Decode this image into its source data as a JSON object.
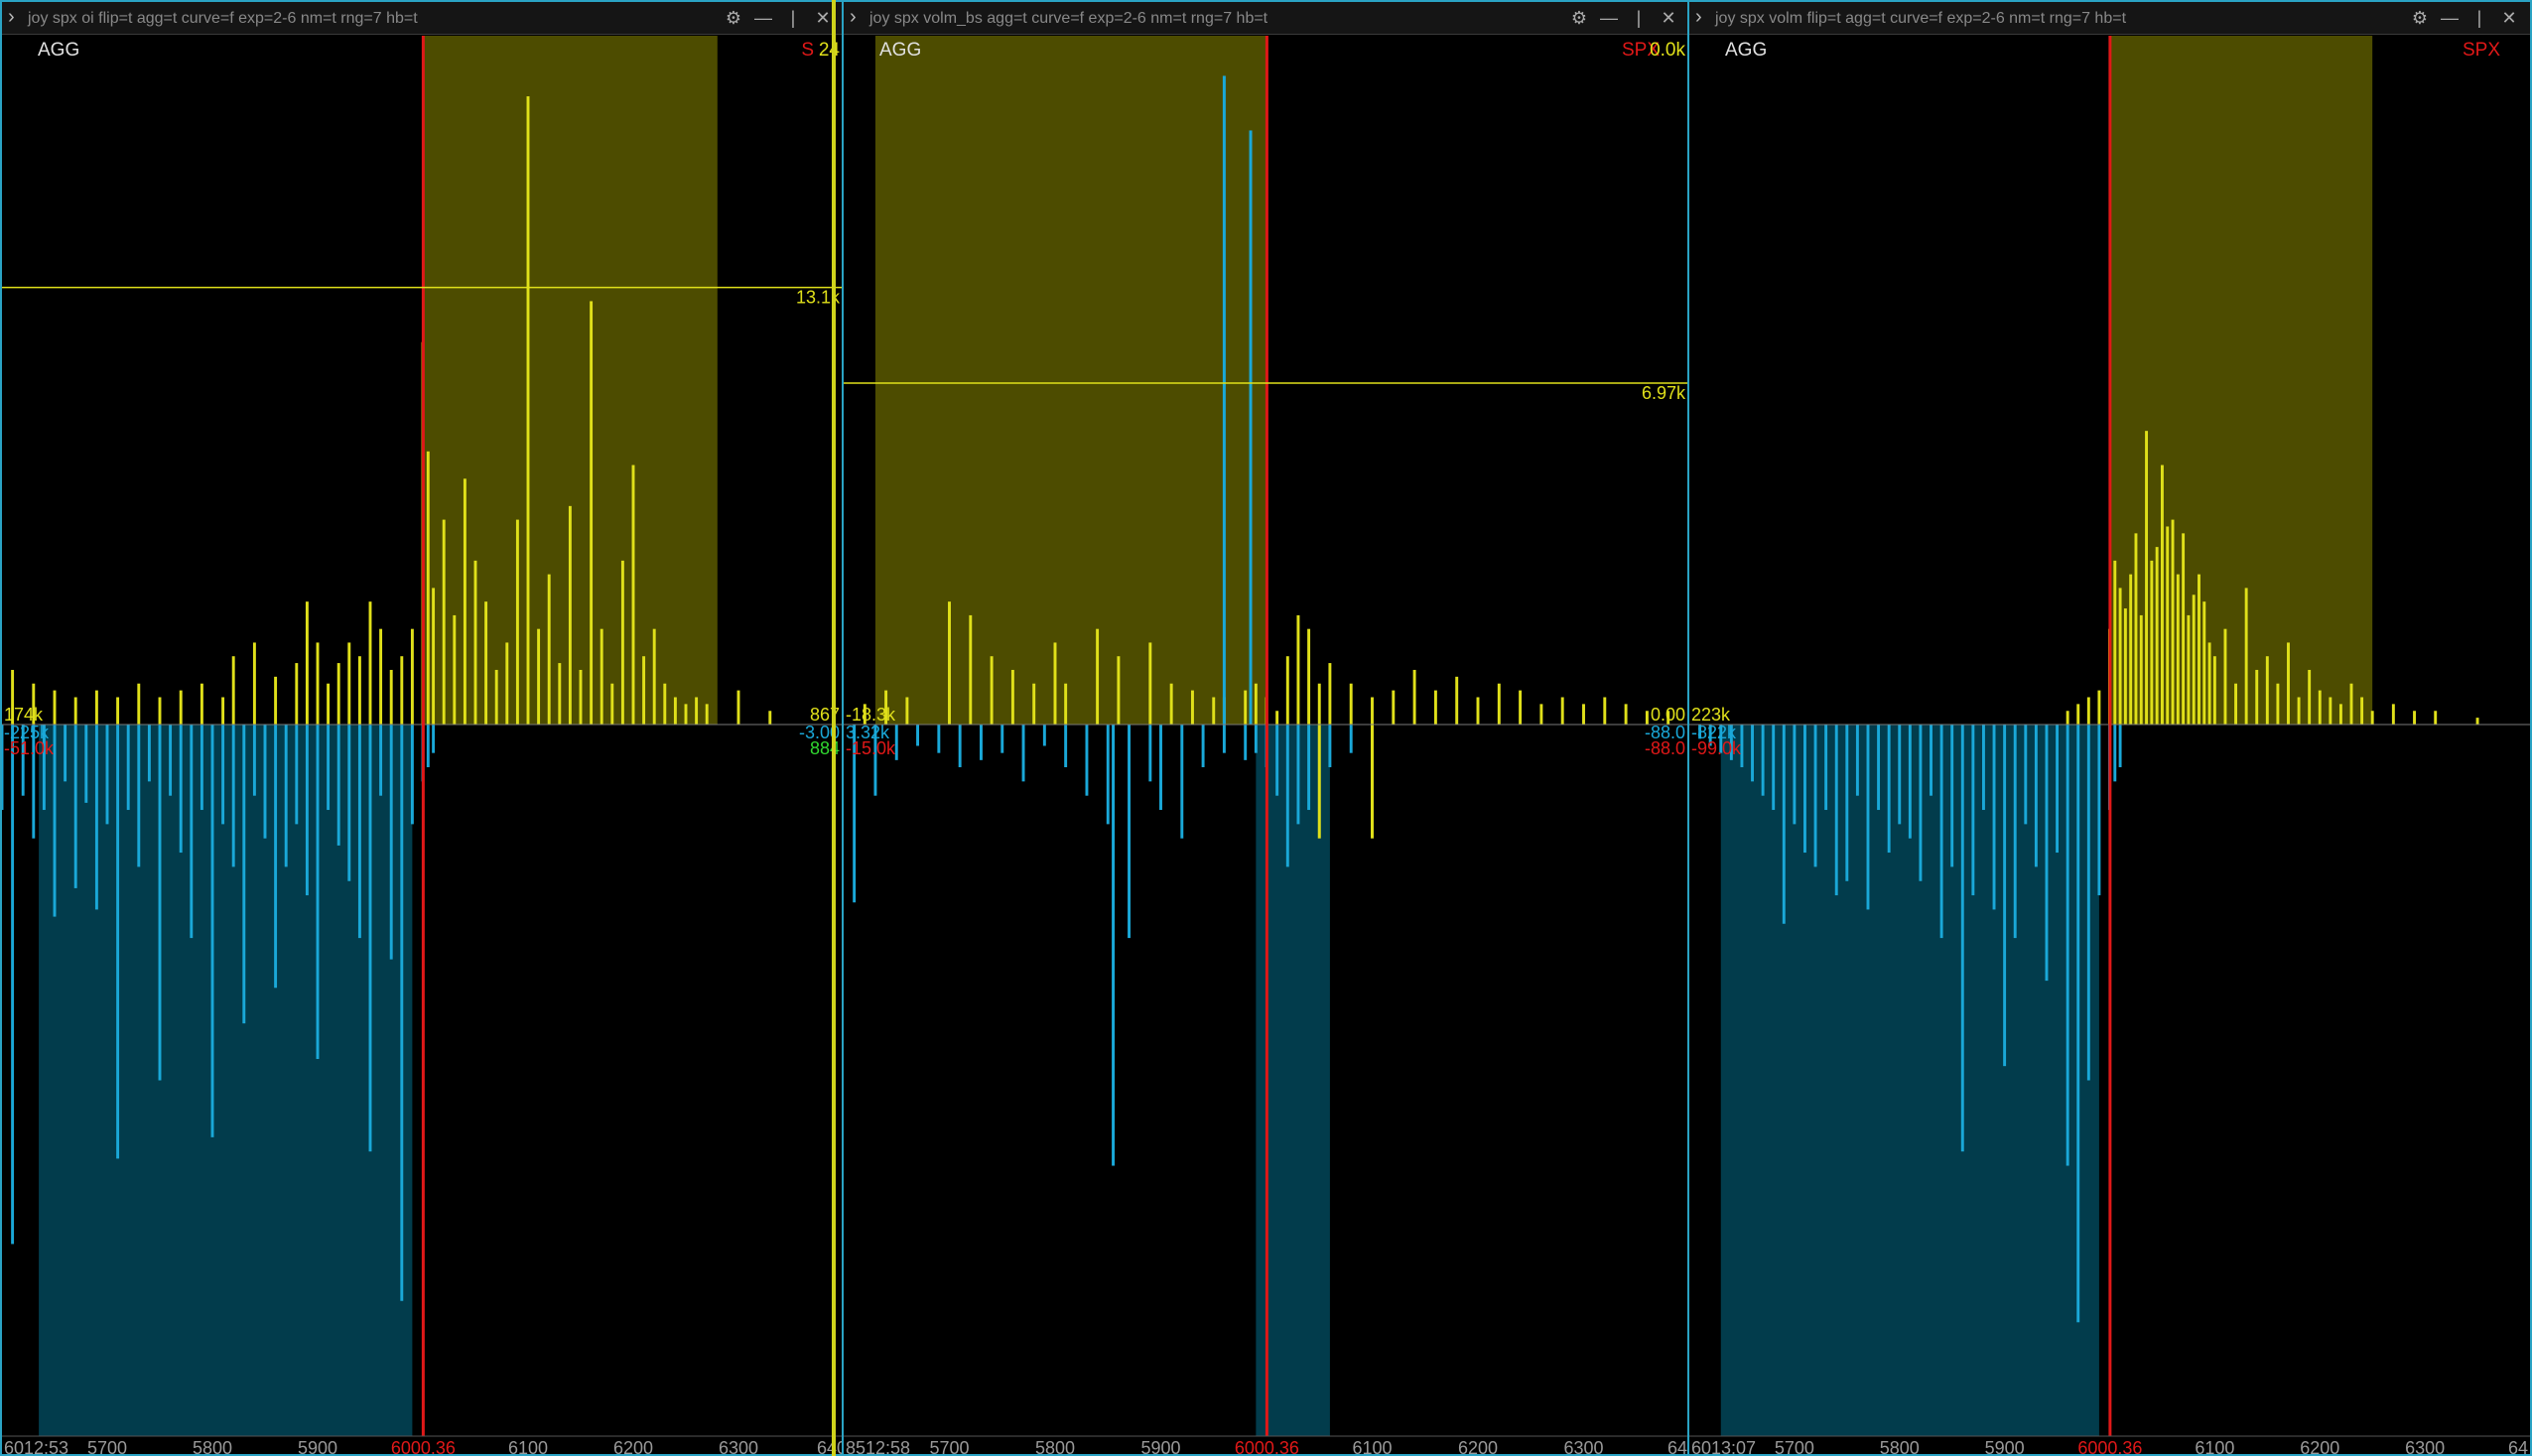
{
  "colors": {
    "yellow": "#e0e01a",
    "cyan": "#1aa8d8",
    "olive_band": "#4d4c00",
    "teal_band": "#023c4c",
    "red": "#e01818",
    "green": "#30d830",
    "border": "#2aa3c4"
  },
  "icons": [
    "chevron-right-icon",
    "gear-icon",
    "minimize-icon",
    "split-icon",
    "close-icon"
  ],
  "panels": [
    {
      "title": "joy spx oi flip=t agg=t curve=f exp=2-6 nm=t rng=7 hb=t",
      "agg_label": "AGG",
      "symbol_label": "S",
      "top_right_value": "24",
      "hline_value": "13.1k",
      "left_value_top": "174k",
      "left_value_mid": "-225k",
      "left_value_bot": "-51.0k",
      "right_value_top": "867",
      "right_value_mid": "-3.00",
      "right_value_bot": "884",
      "time_label": "6012:53",
      "price_marker": "6000.36",
      "x_ticks": [
        "5700",
        "5800",
        "5900",
        "6100",
        "6200",
        "6300",
        "640"
      ]
    },
    {
      "title": "joy spx volm_bs agg=t curve=f exp=2-6 nm=t rng=7 hb=t",
      "agg_label": "AGG",
      "symbol_label": "SPX",
      "top_right_value": "0.0k",
      "hline_value": "6.97k",
      "left_value_top": "-18.3k",
      "left_value_mid": "3.32k",
      "left_value_bot": "-15.0k",
      "right_value_top": "0.00",
      "right_value_mid": "-88.0",
      "right_value_bot": "-88.0",
      "time_label": "8512:58",
      "price_marker": "6000.36",
      "x_ticks": [
        "5700",
        "5800",
        "5900",
        "6100",
        "6200",
        "6300",
        "64"
      ]
    },
    {
      "title": "joy spx volm flip=t agg=t curve=f exp=2-6 nm=t rng=7 hb=t",
      "agg_label": "AGG",
      "symbol_label": "SPX",
      "top_right_value": "",
      "hline_value": "",
      "left_value_top": "223k",
      "left_value_mid": "-822k",
      "left_value_bot": "-99.0k",
      "right_value_top": "",
      "right_value_mid": "",
      "right_value_bot": "",
      "time_label": "6013:07",
      "price_marker": "6000.36",
      "x_ticks": [
        "5700",
        "5800",
        "5900",
        "6100",
        "6200",
        "6300",
        "64"
      ]
    }
  ],
  "chart_data": [
    {
      "type": "bar",
      "xlim": [
        5600,
        6400
      ],
      "price_marker": 6000.36,
      "upper_band": [
        6000,
        6280
      ],
      "lower_band": [
        5635,
        5990
      ],
      "hline_frac": 0.64,
      "series": [
        {
          "color": "yellow",
          "x": [
            5610,
            5630,
            5650,
            5670,
            5690,
            5710,
            5730,
            5750,
            5770,
            5790,
            5810,
            5820,
            5840,
            5860,
            5880,
            5890,
            5900,
            5910,
            5920,
            5930,
            5940,
            5950,
            5960,
            5970,
            5980,
            5990,
            6000,
            6005,
            6010,
            6020,
            6030,
            6040,
            6050,
            6060,
            6070,
            6080,
            6090,
            6100,
            6110,
            6120,
            6130,
            6140,
            6150,
            6160,
            6170,
            6180,
            6190,
            6200,
            6210,
            6220,
            6230,
            6240,
            6250,
            6260,
            6270,
            6300,
            6330
          ],
          "values": [
            0.08,
            0.06,
            0.05,
            0.04,
            0.05,
            0.04,
            0.06,
            0.04,
            0.05,
            0.06,
            0.04,
            0.1,
            0.12,
            0.07,
            0.09,
            0.18,
            0.12,
            0.06,
            0.09,
            0.12,
            0.1,
            0.18,
            0.14,
            0.08,
            0.1,
            0.14,
            0.56,
            0.4,
            0.2,
            0.3,
            0.16,
            0.36,
            0.24,
            0.18,
            0.08,
            0.12,
            0.3,
            0.92,
            0.14,
            0.22,
            0.09,
            0.32,
            0.08,
            0.62,
            0.14,
            0.06,
            0.24,
            0.38,
            0.1,
            0.14,
            0.06,
            0.04,
            0.03,
            0.04,
            0.03,
            0.05,
            0.02
          ]
        },
        {
          "color": "cyan",
          "x": [
            5600,
            5610,
            5620,
            5630,
            5640,
            5650,
            5660,
            5670,
            5680,
            5690,
            5700,
            5710,
            5720,
            5730,
            5740,
            5750,
            5760,
            5770,
            5780,
            5790,
            5800,
            5810,
            5820,
            5830,
            5840,
            5850,
            5860,
            5870,
            5880,
            5890,
            5900,
            5910,
            5920,
            5930,
            5940,
            5950,
            5960,
            5970,
            5980,
            5990,
            6000,
            6005,
            6010
          ],
          "values": [
            -0.12,
            -0.73,
            -0.1,
            -0.16,
            -0.12,
            -0.27,
            -0.08,
            -0.23,
            -0.11,
            -0.26,
            -0.14,
            -0.61,
            -0.12,
            -0.2,
            -0.08,
            -0.5,
            -0.1,
            -0.18,
            -0.3,
            -0.12,
            -0.58,
            -0.14,
            -0.2,
            -0.42,
            -0.1,
            -0.16,
            -0.37,
            -0.2,
            -0.14,
            -0.24,
            -0.47,
            -0.12,
            -0.17,
            -0.22,
            -0.3,
            -0.6,
            -0.1,
            -0.33,
            -0.81,
            -0.14,
            -0.08,
            -0.06,
            -0.04
          ]
        }
      ]
    },
    {
      "type": "bar",
      "xlim": [
        5600,
        6400
      ],
      "price_marker": 6000.36,
      "upper_band": [
        5630,
        6000
      ],
      "lower_band": [
        5990,
        6060
      ],
      "hline_frac": 0.5,
      "series": [
        {
          "color": "yellow",
          "x": [
            5620,
            5640,
            5660,
            5700,
            5720,
            5740,
            5760,
            5780,
            5800,
            5810,
            5840,
            5860,
            5890,
            5910,
            5930,
            5950,
            5960,
            5980,
            5990,
            6000,
            6010,
            6020,
            6030,
            6040,
            6050,
            6060,
            6080,
            6100,
            6120,
            6140,
            6160,
            6180,
            6200,
            6220,
            6240,
            6260,
            6280,
            6300,
            6320,
            6340,
            6360,
            6380
          ],
          "values": [
            0.03,
            0.05,
            0.04,
            0.18,
            0.16,
            0.1,
            0.08,
            0.06,
            0.12,
            0.06,
            0.14,
            0.1,
            0.12,
            0.06,
            0.05,
            0.04,
            0.04,
            0.05,
            0.06,
            0.04,
            0.02,
            0.1,
            0.16,
            0.14,
            0.06,
            0.09,
            0.06,
            0.04,
            0.05,
            0.08,
            0.05,
            0.07,
            0.04,
            0.06,
            0.05,
            0.03,
            0.04,
            0.03,
            0.04,
            0.03,
            0.02,
            0.02
          ]
        },
        {
          "color": "cyan",
          "x": [
            5610,
            5630,
            5650,
            5670,
            5690,
            5710,
            5730,
            5750,
            5770,
            5790,
            5810,
            5830,
            5850,
            5870,
            5890,
            5900,
            5920,
            5940,
            5960,
            5980,
            5990,
            6000,
            6010,
            6020,
            6030,
            6040,
            6060,
            6080,
            6100
          ],
          "values": [
            -0.25,
            -0.1,
            -0.05,
            -0.03,
            -0.04,
            -0.06,
            -0.05,
            -0.04,
            -0.08,
            -0.03,
            -0.06,
            -0.1,
            -0.14,
            -0.3,
            -0.08,
            -0.12,
            -0.16,
            -0.06,
            -0.04,
            -0.05,
            -0.04,
            -0.06,
            -0.1,
            -0.2,
            -0.14,
            -0.12,
            -0.06,
            -0.04,
            -0.03
          ]
        }
      ],
      "tall_bars": [
        {
          "x": 5960,
          "value": 0.95,
          "color": "cyan"
        },
        {
          "x": 5985,
          "value": 0.87,
          "color": "cyan"
        },
        {
          "x": 5855,
          "value": -0.62,
          "color": "cyan"
        },
        {
          "x": 6050,
          "value": -0.16,
          "color": "yellow"
        },
        {
          "x": 6100,
          "value": -0.16,
          "color": "yellow"
        }
      ]
    },
    {
      "type": "bar",
      "xlim": [
        5600,
        6400
      ],
      "price_marker": 6000.36,
      "upper_band": [
        6000,
        6250
      ],
      "lower_band": [
        5630,
        5990
      ],
      "hline_frac": null,
      "series": [
        {
          "color": "yellow",
          "x": [
            5960,
            5970,
            5980,
            5990,
            6000,
            6005,
            6010,
            6015,
            6020,
            6025,
            6030,
            6035,
            6040,
            6045,
            6050,
            6055,
            6060,
            6065,
            6070,
            6075,
            6080,
            6085,
            6090,
            6095,
            6100,
            6110,
            6120,
            6130,
            6140,
            6150,
            6160,
            6170,
            6180,
            6190,
            6200,
            6210,
            6220,
            6230,
            6240,
            6250,
            6270,
            6290,
            6310,
            6350
          ],
          "values": [
            0.02,
            0.03,
            0.04,
            0.05,
            0.14,
            0.24,
            0.2,
            0.17,
            0.22,
            0.28,
            0.16,
            0.43,
            0.24,
            0.26,
            0.38,
            0.29,
            0.3,
            0.22,
            0.28,
            0.16,
            0.19,
            0.22,
            0.18,
            0.12,
            0.1,
            0.14,
            0.06,
            0.2,
            0.08,
            0.1,
            0.06,
            0.12,
            0.04,
            0.08,
            0.05,
            0.04,
            0.03,
            0.06,
            0.04,
            0.02,
            0.03,
            0.02,
            0.02,
            0.01
          ]
        },
        {
          "color": "cyan",
          "x": [
            5610,
            5620,
            5630,
            5640,
            5650,
            5660,
            5670,
            5680,
            5690,
            5700,
            5710,
            5720,
            5730,
            5740,
            5750,
            5760,
            5770,
            5780,
            5790,
            5800,
            5810,
            5820,
            5830,
            5840,
            5850,
            5860,
            5870,
            5880,
            5890,
            5900,
            5910,
            5920,
            5930,
            5940,
            5950,
            5960,
            5970,
            5980,
            5990,
            6000,
            6005,
            6010
          ],
          "values": [
            -0.02,
            -0.03,
            -0.04,
            -0.05,
            -0.06,
            -0.08,
            -0.1,
            -0.12,
            -0.28,
            -0.14,
            -0.18,
            -0.2,
            -0.12,
            -0.24,
            -0.22,
            -0.1,
            -0.26,
            -0.12,
            -0.18,
            -0.14,
            -0.16,
            -0.22,
            -0.1,
            -0.3,
            -0.2,
            -0.6,
            -0.24,
            -0.12,
            -0.26,
            -0.48,
            -0.3,
            -0.14,
            -0.2,
            -0.36,
            -0.18,
            -0.62,
            -0.84,
            -0.5,
            -0.24,
            -0.12,
            -0.08,
            -0.06
          ]
        }
      ]
    }
  ]
}
